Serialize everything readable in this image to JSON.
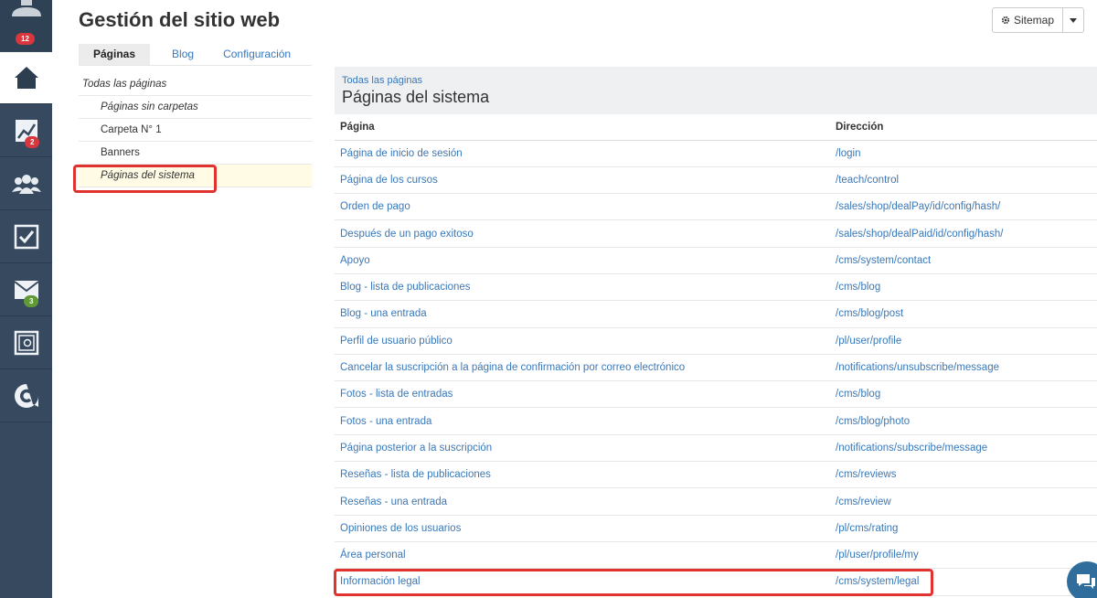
{
  "rail": {
    "badges": {
      "top": "12",
      "chart": "2",
      "mail": "3"
    },
    "icons": [
      "user-avatar-icon",
      "home-icon",
      "chart-icon",
      "users-icon",
      "checkbox-icon",
      "mail-icon",
      "safe-icon",
      "logo-c-icon"
    ]
  },
  "header": {
    "title": "Gestión del sitio web",
    "sitemap_label": "Sitemap"
  },
  "tabs": [
    {
      "label": "Páginas",
      "active": true
    },
    {
      "label": "Blog",
      "active": false
    },
    {
      "label": "Configuración",
      "active": false
    }
  ],
  "tree": [
    {
      "label": "Todas las páginas"
    },
    {
      "label": "Páginas sin carpetas"
    },
    {
      "label": "Carpeta N° 1"
    },
    {
      "label": "Banners"
    },
    {
      "label": "Páginas del sistema",
      "selected": true
    }
  ],
  "content": {
    "breadcrumb": "Todas las páginas",
    "title": "Páginas del sistema",
    "columns": [
      "Página",
      "Dirección"
    ],
    "rows": [
      {
        "page": "Página de inicio de sesión",
        "address": "/login"
      },
      {
        "page": "Página de los cursos",
        "address": "/teach/control"
      },
      {
        "page": "Orden de pago",
        "address": "/sales/shop/dealPay/id/config/hash/"
      },
      {
        "page": "Después de un pago exitoso",
        "address": "/sales/shop/dealPaid/id/config/hash/"
      },
      {
        "page": "Apoyo",
        "address": "/cms/system/contact"
      },
      {
        "page": "Blog - lista de publicaciones",
        "address": "/cms/blog"
      },
      {
        "page": "Blog - una entrada",
        "address": "/cms/blog/post"
      },
      {
        "page": "Perfil de usuario público",
        "address": "/pl/user/profile"
      },
      {
        "page": "Cancelar la suscripción a la página de confirmación por correo electrónico",
        "address": "/notifications/unsubscribe/message"
      },
      {
        "page": "Fotos - lista de entradas",
        "address": "/cms/blog"
      },
      {
        "page": "Fotos - una entrada",
        "address": "/cms/blog/photo"
      },
      {
        "page": "Página posterior a la suscripción",
        "address": "/notifications/subscribe/message"
      },
      {
        "page": "Reseñas - lista de publicaciones",
        "address": "/cms/reviews"
      },
      {
        "page": "Reseñas - una entrada",
        "address": "/cms/review"
      },
      {
        "page": "Opiniones de los usuarios",
        "address": "/pl/cms/rating"
      },
      {
        "page": "Área personal",
        "address": "/pl/user/profile/my"
      },
      {
        "page": "Información legal",
        "address": "/cms/system/legal"
      }
    ]
  },
  "colors": {
    "rail": "#36495f",
    "link": "#3a78b8",
    "highlight": "#e0332f",
    "selected_bg": "#fffbe5"
  }
}
